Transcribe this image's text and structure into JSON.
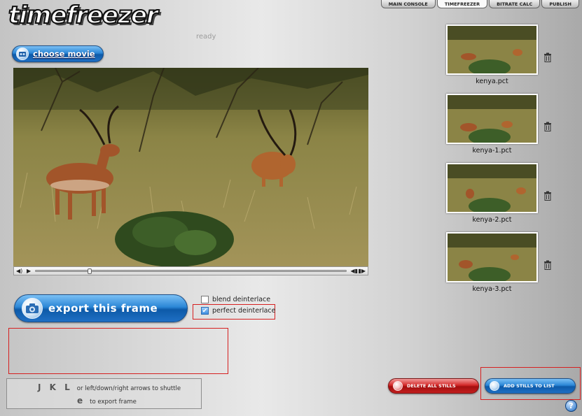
{
  "app": {
    "logo_text": "timefreezer",
    "status": "ready"
  },
  "tabs": [
    {
      "label": "MAIN CONSOLE",
      "active": false
    },
    {
      "label": "TIMEFREEZER",
      "active": true
    },
    {
      "label": "BITRATE CALC",
      "active": false
    },
    {
      "label": "PUBLISH",
      "active": false
    }
  ],
  "toolbar": {
    "choose_movie": "choose movie",
    "export_frame": "export this frame"
  },
  "options": {
    "blend": {
      "label": "blend deinterlace",
      "checked": false
    },
    "perfect": {
      "label": "perfect deinterlace",
      "checked": true
    }
  },
  "shortcuts": {
    "line1_keys": "J K L",
    "line1_desc": "or left/down/right arrows to shuttle",
    "line2_key": "e",
    "line2_desc": "to export frame"
  },
  "stills": [
    {
      "name": "kenya.pct"
    },
    {
      "name": "kenya-1.pct"
    },
    {
      "name": "kenya-2.pct"
    },
    {
      "name": "kenya-3.pct"
    }
  ],
  "actions": {
    "delete_all": "DELETE ALL STILLS",
    "add_stills": "ADD STILLS TO LIST",
    "help": "?"
  },
  "colors": {
    "blue_button": "#1f6fc4",
    "red_button": "#c21e1e",
    "highlight_border": "#d62020"
  }
}
